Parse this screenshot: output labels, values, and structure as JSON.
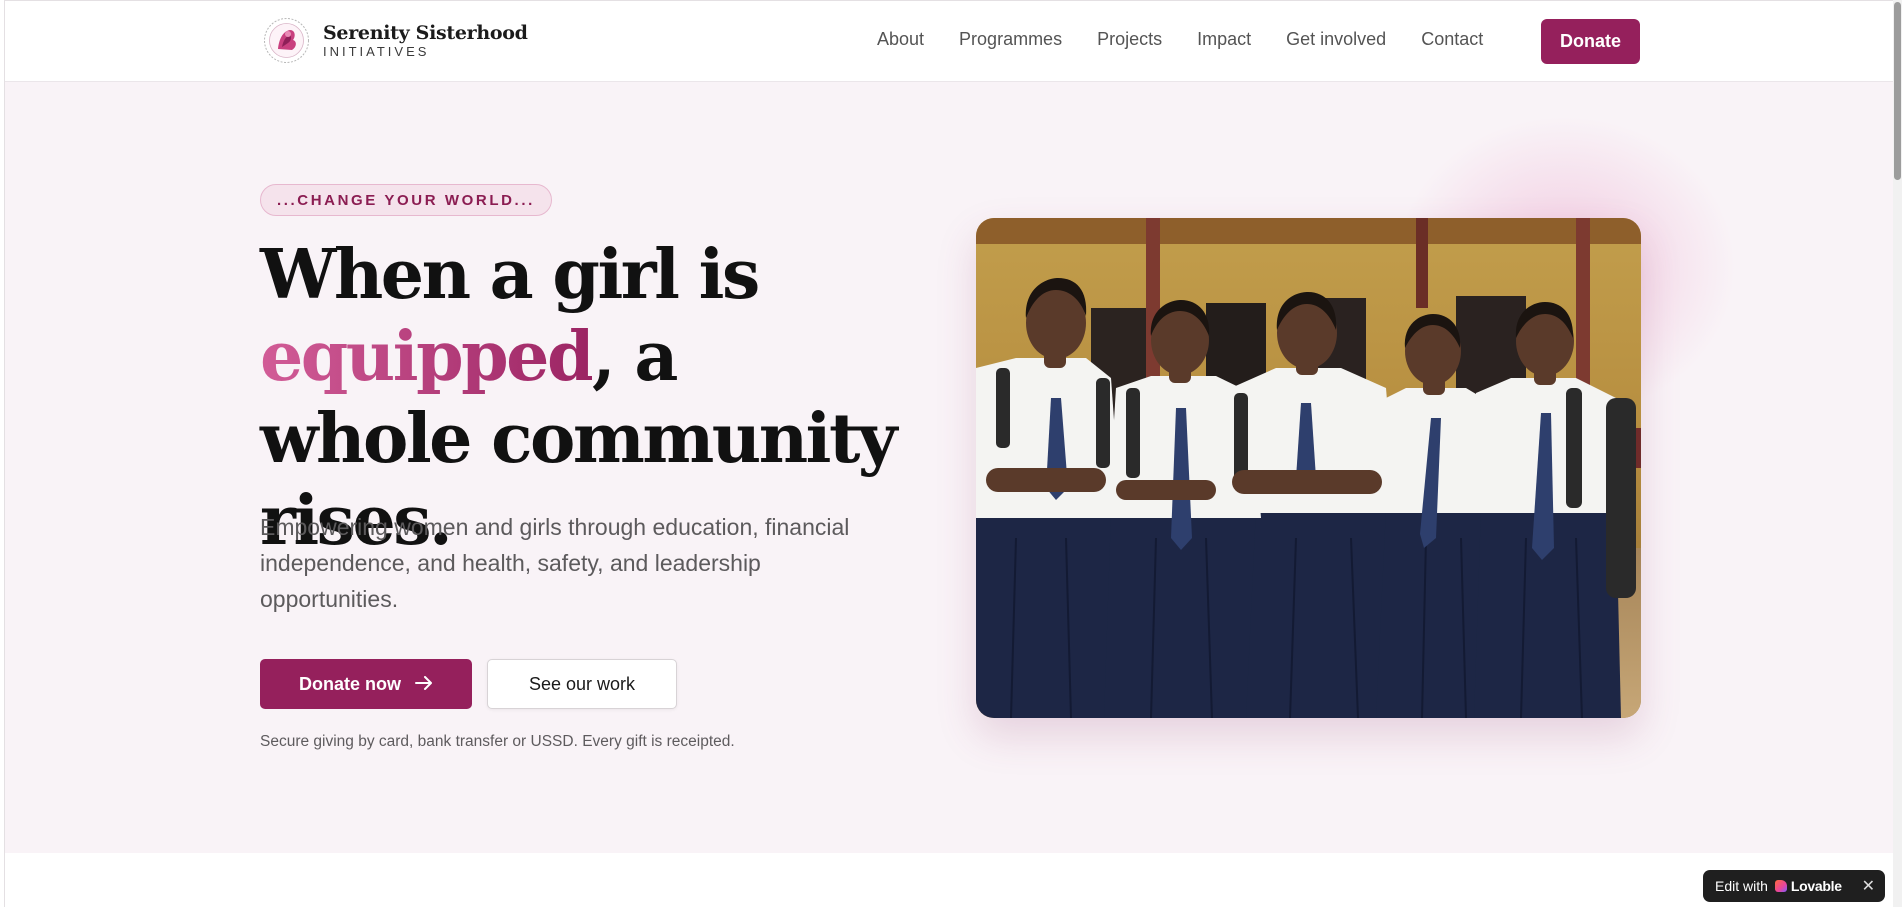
{
  "header": {
    "brand_name": "Serenity Sisterhood",
    "brand_sub": "INITIATIVES",
    "nav": [
      "About",
      "Programmes",
      "Projects",
      "Impact",
      "Get involved",
      "Contact"
    ],
    "donate_label": "Donate"
  },
  "hero": {
    "eyebrow": "...CHANGE YOUR WORLD...",
    "headline_part1": "When a girl is",
    "headline_accent": "equipped",
    "headline_part2": ", a whole community rises.",
    "lead": "Empowering women and girls through education, financial independence, and health, safety, and leadership opportunities.",
    "primary_cta": "Donate now",
    "secondary_cta": "See our work",
    "fine_print": "Secure giving by card, bank transfer or USSD. Every gift is receipted."
  },
  "badge": {
    "prefix": "Edit with",
    "brand": "Lovable"
  },
  "colors": {
    "brand": "#95205c",
    "accent_start": "#d25c97",
    "hero_bg": "#f9f3f7"
  },
  "icons": {
    "cta_arrow": "arrow-right-icon",
    "close": "close-icon"
  }
}
